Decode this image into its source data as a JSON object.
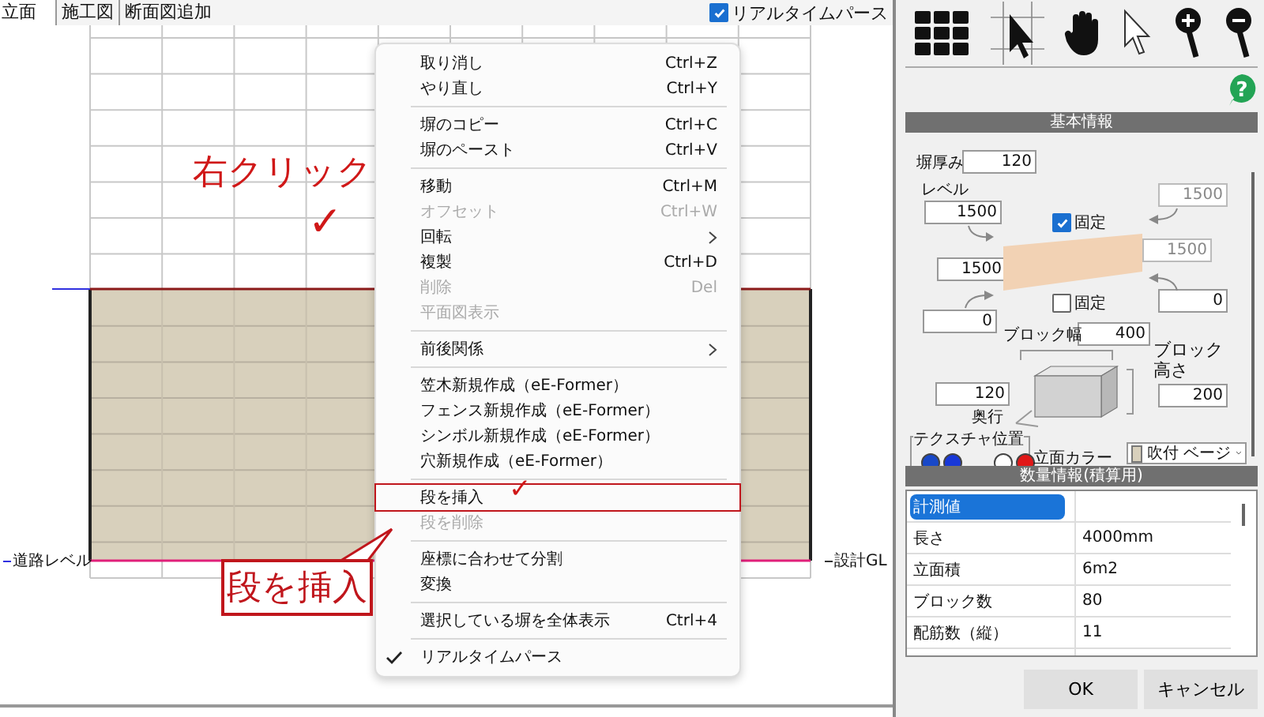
{
  "tabs": [
    {
      "label": "立面",
      "selected": true
    },
    {
      "label": "施工図",
      "selected": false
    },
    {
      "label": "断面図追加",
      "selected": false
    }
  ],
  "realtime_toggle": {
    "label": "リアルタイムパース",
    "checked": true
  },
  "canvas": {
    "left_label": "道路レベル",
    "right_label": "設計GL"
  },
  "help": "?",
  "annotation": {
    "right_click": "右クリック",
    "right_click_mark": "✓",
    "callout": "段を挿入",
    "callout_mark": "✓"
  },
  "context_menu": [
    {
      "kind": "item",
      "label": "取り消し",
      "shortcut": "Ctrl+Z",
      "disabled": false,
      "checked": false,
      "annotated": false
    },
    {
      "kind": "item",
      "label": "やり直し",
      "shortcut": "Ctrl+Y",
      "disabled": false,
      "checked": false,
      "annotated": false
    },
    {
      "kind": "separator"
    },
    {
      "kind": "item",
      "label": "塀のコピー",
      "shortcut": "Ctrl+C",
      "disabled": false,
      "checked": false,
      "annotated": false
    },
    {
      "kind": "item",
      "label": "塀のペースト",
      "shortcut": "Ctrl+V",
      "disabled": false,
      "checked": false,
      "annotated": false
    },
    {
      "kind": "separator"
    },
    {
      "kind": "item",
      "label": "移動",
      "shortcut": "Ctrl+M",
      "disabled": false,
      "checked": false,
      "annotated": false
    },
    {
      "kind": "item",
      "label": "オフセット",
      "shortcut": "Ctrl+W",
      "disabled": true,
      "checked": false,
      "annotated": false
    },
    {
      "kind": "submenu",
      "label": "回転",
      "disabled": false,
      "checked": false,
      "annotated": false
    },
    {
      "kind": "item",
      "label": "複製",
      "shortcut": "Ctrl+D",
      "disabled": false,
      "checked": false,
      "annotated": false
    },
    {
      "kind": "item",
      "label": "削除",
      "shortcut": "Del",
      "disabled": true,
      "checked": false,
      "annotated": false
    },
    {
      "kind": "item",
      "label": "平面図表示",
      "disabled": true,
      "checked": false,
      "annotated": false
    },
    {
      "kind": "separator"
    },
    {
      "kind": "submenu",
      "label": "前後関係",
      "disabled": false,
      "checked": false,
      "annotated": false
    },
    {
      "kind": "separator"
    },
    {
      "kind": "item",
      "label": "笠木新規作成（eE-Former）",
      "disabled": false,
      "checked": false,
      "annotated": false
    },
    {
      "kind": "item",
      "label": "フェンス新規作成（eE-Former）",
      "disabled": false,
      "checked": false,
      "annotated": false
    },
    {
      "kind": "item",
      "label": "シンボル新規作成（eE-Former）",
      "disabled": false,
      "checked": false,
      "annotated": false
    },
    {
      "kind": "item",
      "label": "穴新規作成（eE-Former）",
      "disabled": false,
      "checked": false,
      "annotated": false
    },
    {
      "kind": "separator"
    },
    {
      "kind": "item",
      "label": "段を挿入",
      "disabled": false,
      "checked": false,
      "annotated": true
    },
    {
      "kind": "item",
      "label": "段を削除",
      "disabled": true,
      "checked": false,
      "annotated": false
    },
    {
      "kind": "separator"
    },
    {
      "kind": "item",
      "label": "座標に合わせて分割",
      "disabled": false,
      "checked": false,
      "annotated": false
    },
    {
      "kind": "item",
      "label": "変換",
      "disabled": false,
      "checked": false,
      "annotated": false
    },
    {
      "kind": "separator"
    },
    {
      "kind": "item",
      "label": "選択している塀を全体表示",
      "shortcut": "Ctrl+4",
      "disabled": false,
      "checked": false,
      "annotated": false
    },
    {
      "kind": "separator"
    },
    {
      "kind": "item",
      "label": "リアルタイムパース",
      "disabled": false,
      "checked": true,
      "annotated": false
    }
  ],
  "basic_info": {
    "title": "基本情報",
    "thickness_label": "塀厚み",
    "thickness": {
      "value": "120",
      "disabled": false
    },
    "level_label": "レベル",
    "level_top_left": {
      "value": "1500",
      "disabled": false
    },
    "level_top_right": {
      "value": "1500",
      "disabled": true
    },
    "level_mid_right": {
      "value": "1500",
      "disabled": true
    },
    "level_mid_left": {
      "value": "1500",
      "disabled": false
    },
    "level_bottom_right": {
      "value": "0",
      "disabled": false
    },
    "level_bottom_left": {
      "value": "0",
      "disabled": false
    },
    "fix_top": {
      "label": "固定",
      "checked": true
    },
    "fix_bottom": {
      "label": "固定",
      "checked": false
    },
    "block_width_label": "ブロック幅",
    "block_width": {
      "value": "400",
      "disabled": false
    },
    "block_height_label": "ブロック高さ",
    "block_height": {
      "value": "200",
      "disabled": false
    },
    "depth_label": "奥行",
    "depth": {
      "value": "120",
      "disabled": false
    },
    "texture_label": "テクスチャ位置",
    "texture_dots": [
      {
        "color": "#1848c8"
      },
      {
        "color": "#1838d8"
      },
      {
        "color": "#ffffff"
      },
      {
        "color": "#e01818"
      }
    ],
    "facade_color_label": "立面カラー",
    "facade_color": "吹付 ベージ"
  },
  "quantity_info": {
    "title": "数量情報(積算用)",
    "rows": [
      {
        "name": "計測値",
        "selected": true
      },
      {
        "name": "長さ",
        "value": "4000mm",
        "selected": false
      },
      {
        "name": "立面積",
        "value": "6m2",
        "selected": false
      },
      {
        "name": "ブロック数",
        "value": "80",
        "selected": false
      },
      {
        "name": "配筋数（縦）",
        "value": "11",
        "selected": false
      }
    ]
  },
  "buttons": [
    "OK",
    "キャンセル"
  ]
}
